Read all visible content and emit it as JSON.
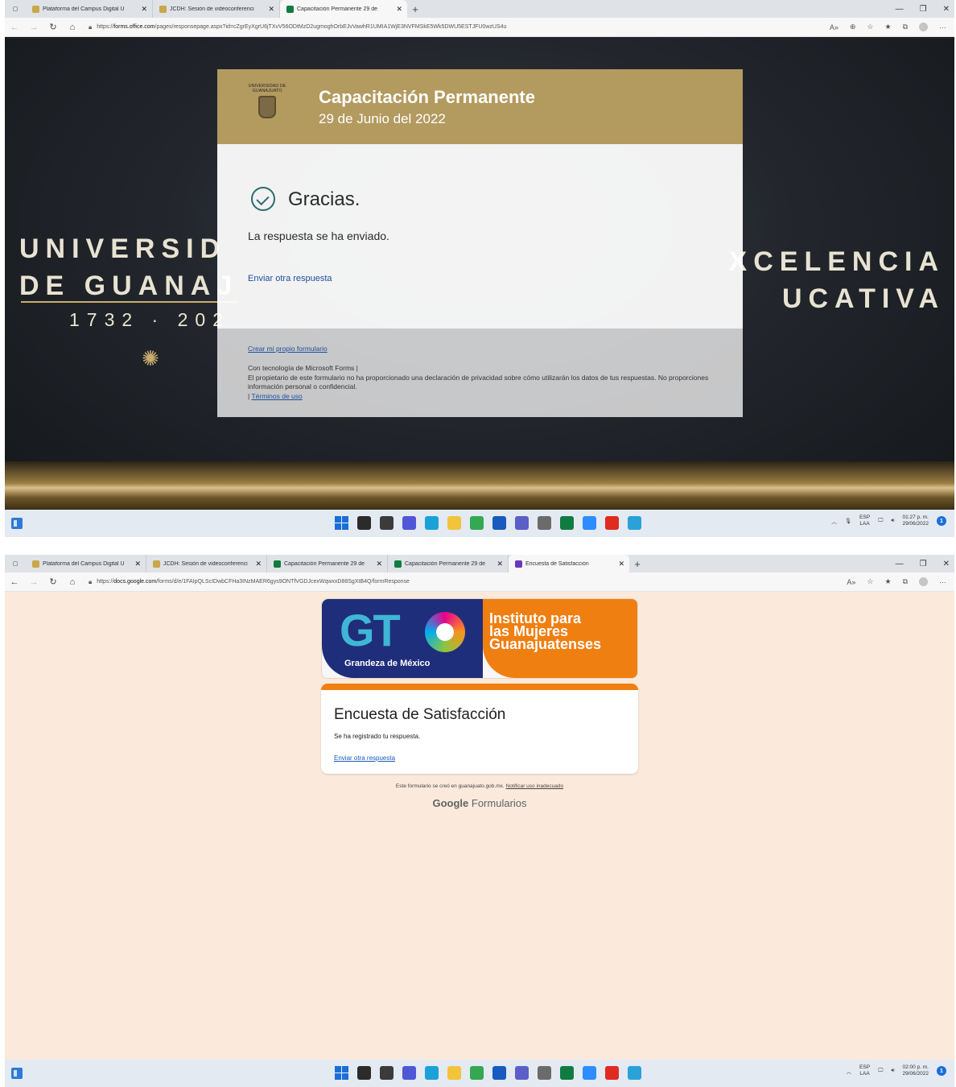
{
  "shot1": {
    "tabs": [
      {
        "title": "Plataforma del Campus Digital U",
        "fav_color": "#c9a84a",
        "active": false
      },
      {
        "title": "JCDH: Sesión de videoconferenci",
        "fav_color": "#c9a84a",
        "active": false
      },
      {
        "title": "Capacitación Permanente 29 de",
        "fav_color": "#107c41",
        "active": true
      }
    ],
    "url_prefix": "https://",
    "url_host": "forms.office.com",
    "url_path": "/pages/responsepage.aspx?id=cZgrEyXgrU6jTXvV56ODtMzD2ugmoghOrbEJvVawhR1UMIA1WjE3NVFMSkE5Wk5DWU5ESTJFU0wzUS4u",
    "hero": {
      "left_line1": "UNIVERSID",
      "left_line2": "DE GUANAJ",
      "years": "1732 · 202",
      "right_line1": "XCELENCIA",
      "right_line2": "UCATIVA"
    },
    "form": {
      "logo_text": "UNIVERSIDAD DE GUANAJUATO",
      "title": "Capacitación Permanente",
      "subtitle": "29 de Junio del 2022",
      "thanks": "Gracias.",
      "sent": "La respuesta se ha enviado.",
      "another": "Enviar otra respuesta",
      "create_own": "Crear mi propio formulario",
      "powered": "Con tecnología de Microsoft Forms |",
      "privacy": "El propietario de este formulario no ha proporcionado una declaración de privacidad sobre cómo utilizarán los datos de tus respuestas. No proporciones información personal o confidencial.",
      "terms_prefix": "|",
      "terms": "Términos de uso"
    },
    "tray": {
      "lang": "ESP",
      "region": "LAA",
      "time": "01:27 p. m.",
      "date": "29/06/2022",
      "notif": "1"
    }
  },
  "shot2": {
    "tabs": [
      {
        "title": "Plataforma del Campus Digital U",
        "fav_color": "#c9a84a",
        "active": false
      },
      {
        "title": "JCDH: Sesión de videoconferenci",
        "fav_color": "#c9a84a",
        "active": false
      },
      {
        "title": "Capacitación Permanente 29 de",
        "fav_color": "#107c41",
        "active": false
      },
      {
        "title": "Capacitación Permanente 29 de",
        "fav_color": "#107c41",
        "active": false
      },
      {
        "title": "Encuesta de Satisfacción",
        "fav_color": "#673ab7",
        "active": true
      }
    ],
    "url_prefix": "https://",
    "url_host": "docs.google.com",
    "url_path": "/forms/d/e/1FAIpQLScIDwbCFHa3INzMAER6gys9ONTfVGDJcexWqwxxD88SgXtB4Q/formResponse",
    "banner": {
      "logo": "GT",
      "tagline": "Grandeza de México",
      "institute_line1": "Instituto para",
      "institute_line2": "las Mujeres",
      "institute_line3": "Guanajuatenses"
    },
    "card": {
      "title": "Encuesta de Satisfacción",
      "registered": "Se ha registrado tu respuesta.",
      "another": "Enviar otra respuesta"
    },
    "note": "Este formulario se creó en guanajuato.gob.mx.",
    "report": "Notificar uso inadecuado",
    "brand_google": "Google",
    "brand_forms": "Formularios",
    "tray": {
      "lang": "ESP",
      "region": "LAA",
      "time": "02:00 p. m.",
      "date": "29/06/2022",
      "notif": "1"
    }
  },
  "taskbar_apps": [
    {
      "icon": "search-icon",
      "color": "#2b2b2b"
    },
    {
      "icon": "task-view-icon",
      "color": "#3b3b3b"
    },
    {
      "icon": "chat-icon",
      "color": "#4f57d8"
    },
    {
      "icon": "edge-icon",
      "color": "#1aa2d8"
    },
    {
      "icon": "file-explorer-icon",
      "color": "#f3c33c"
    },
    {
      "icon": "chrome-icon",
      "color": "#34a853"
    },
    {
      "icon": "word-icon",
      "color": "#185abd"
    },
    {
      "icon": "teams-icon",
      "color": "#5b5fc7"
    },
    {
      "icon": "calculator-icon",
      "color": "#6b6b6b"
    },
    {
      "icon": "excel-icon",
      "color": "#107c41"
    },
    {
      "icon": "zoom-icon",
      "color": "#2d8cff"
    },
    {
      "icon": "acrobat-icon",
      "color": "#e02b20"
    },
    {
      "icon": "snip-icon",
      "color": "#2aa1d8"
    }
  ]
}
